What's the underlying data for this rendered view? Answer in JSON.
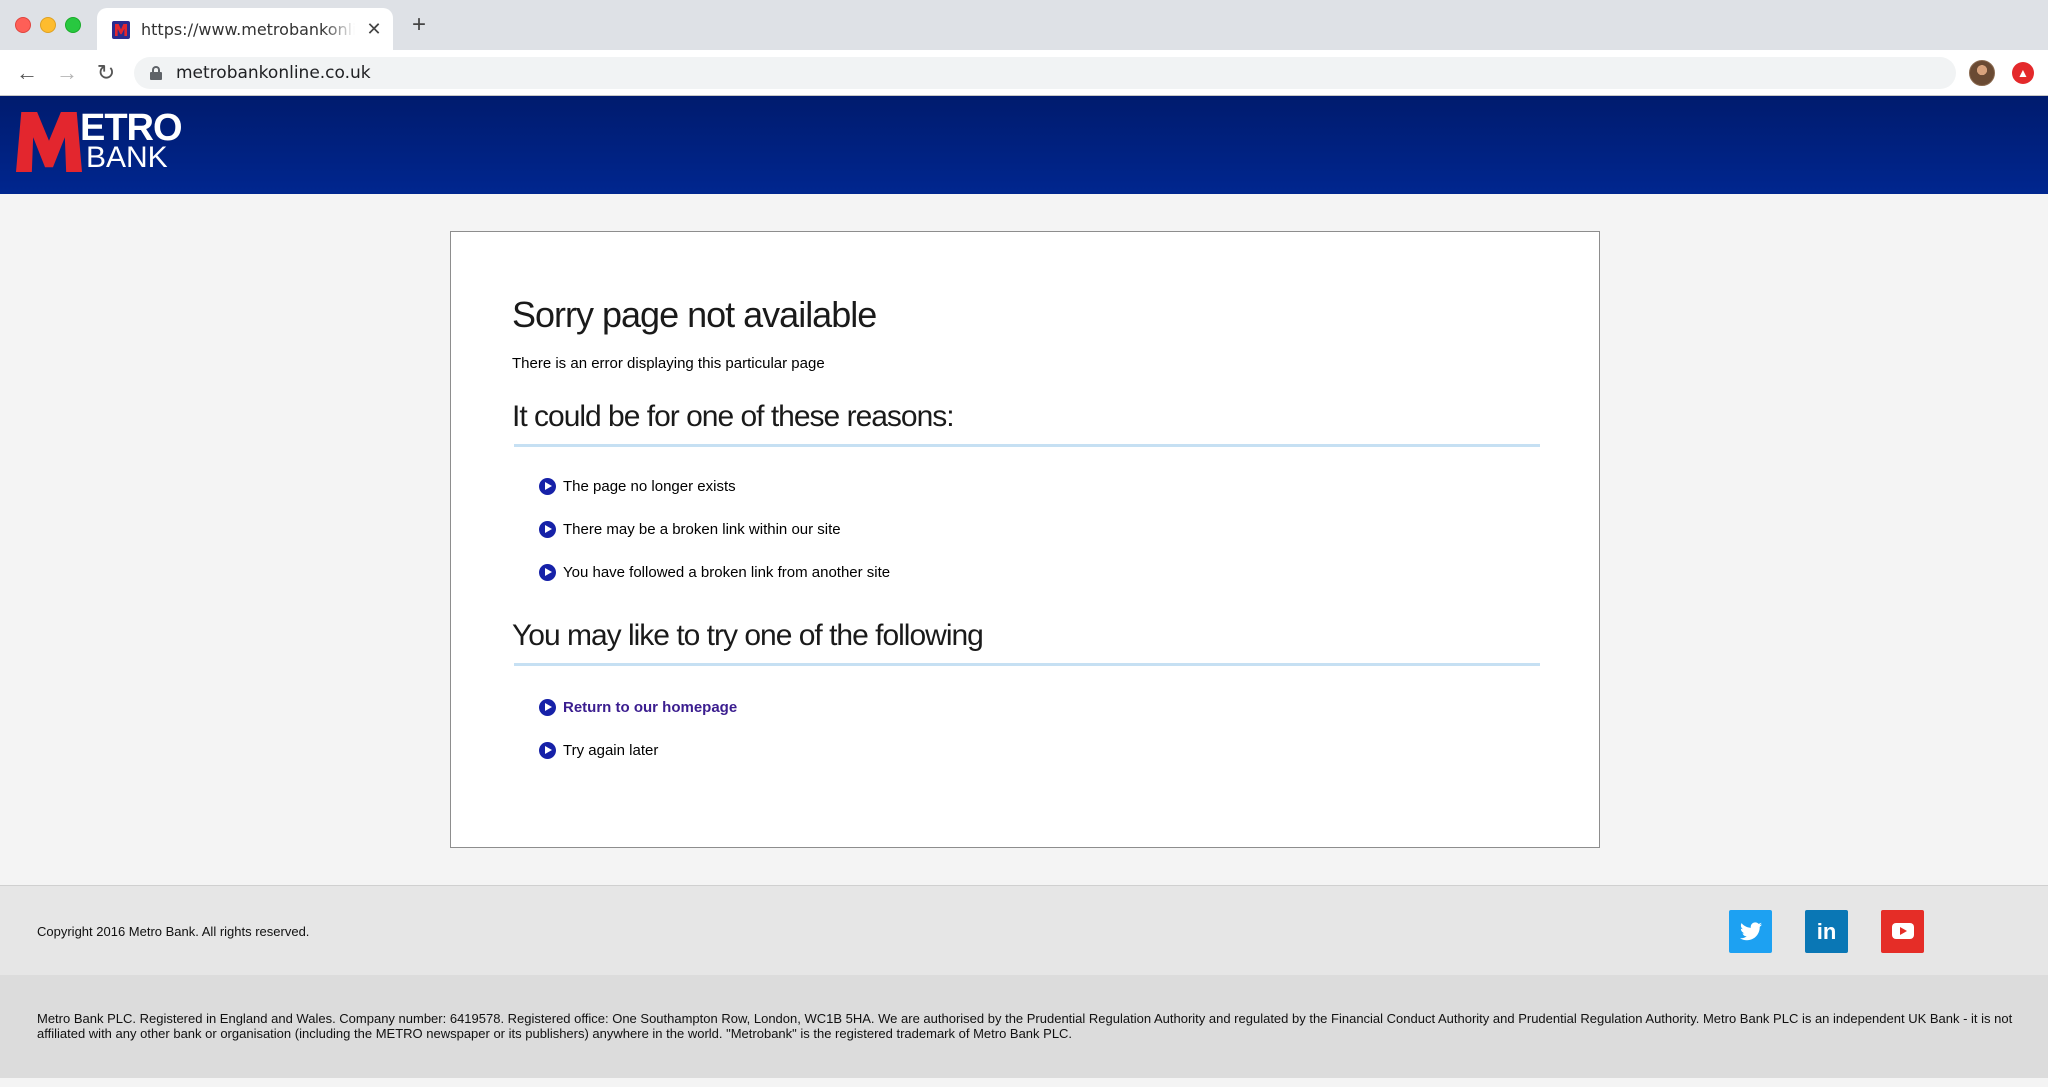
{
  "browser": {
    "tab_title": "https://www.metrobankonline.co.uk",
    "tab_close": "✕",
    "new_tab": "+",
    "url": "metrobankonline.co.uk"
  },
  "logo": {
    "etro": "ETRO",
    "bank": "BANK"
  },
  "main": {
    "title": "Sorry page not available",
    "subtitle": "There is an error displaying this particular page",
    "reasons_heading": "It could be for one of these reasons:",
    "reasons": [
      "The page no longer exists",
      "There may be a broken link within our site",
      "You have followed a broken link from another site"
    ],
    "suggest_heading": "You may like to try one of the following",
    "suggestions": {
      "homepage_link": "Return to our homepage",
      "try_later": "Try again later"
    }
  },
  "footer": {
    "copyright": "Copyright 2016 Metro Bank. All rights reserved.",
    "social": {
      "twitter_icon": "twitter-icon",
      "linkedin_label": "in",
      "youtube_icon": "youtube-icon"
    },
    "legal": "Metro Bank PLC. Registered in England and Wales. Company number: 6419578. Registered office: One Southampton Row, London, WC1B 5HA. We are authorised by the Prudential Regulation Authority and regulated by the Financial Conduct Authority and Prudential Regulation Authority. Metro Bank PLC is an independent UK Bank - it is not affiliated with any other bank or organisation (including the METRO newspaper or its publishers) anywhere in the world. \"Metrobank\" is the registered trademark of Metro Bank PLC."
  },
  "colors": {
    "header_blue": "#00268f",
    "logo_red": "#e3262e",
    "bullet_blue": "#1621a8",
    "link_purple": "#3b1d8f",
    "rule_blue": "#c6e0f3",
    "twitter": "#1da1f2",
    "linkedin": "#0a77b5",
    "youtube": "#e52d27"
  }
}
